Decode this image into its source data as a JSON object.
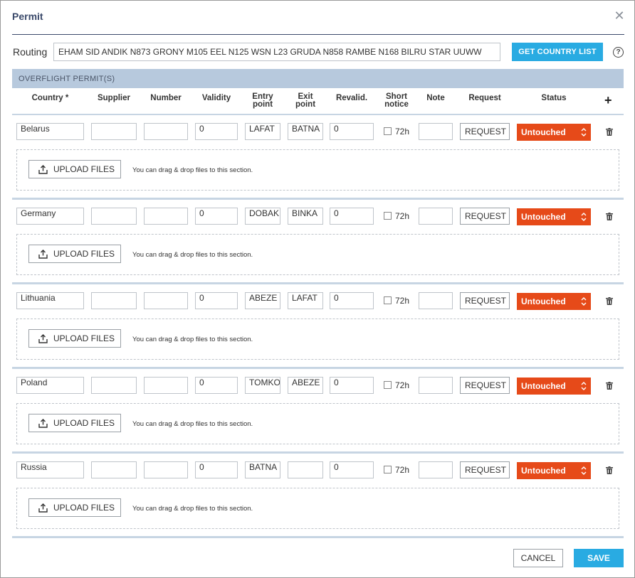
{
  "dialog": {
    "title": "Permit",
    "close_icon": "close-icon"
  },
  "routing": {
    "label": "Routing",
    "value": "EHAM SID ANDIK N873 GRONY M105 EEL N125 WSN L23 GRUDA N858 RAMBE N168 BILRU STAR UUWW",
    "get_country_list": "GET COUNTRY LIST",
    "help_glyph": "?"
  },
  "section": {
    "title": "OVERFLIGHT PERMIT(S)"
  },
  "columns": {
    "country": "Country *",
    "supplier": "Supplier",
    "number": "Number",
    "validity": "Validity",
    "entry_1": "Entry",
    "entry_2": "point",
    "exit_1": "Exit",
    "exit_2": "point",
    "revalid": "Revalid.",
    "short_1": "Short",
    "short_2": "notice",
    "note": "Note",
    "request": "Request",
    "status": "Status",
    "add": "+"
  },
  "permits": [
    {
      "country": "Belarus",
      "supplier": "",
      "number": "",
      "validity": "0",
      "entry": "LAFAT",
      "exit": "BATNA",
      "revalid": "0",
      "short_notice": "72h",
      "note": "",
      "request": "REQUEST",
      "status": "Untouched",
      "upload": "UPLOAD FILES",
      "hint": "You can drag & drop files to this section."
    },
    {
      "country": "Germany",
      "supplier": "",
      "number": "",
      "validity": "0",
      "entry": "DOBAK",
      "exit": "BINKA",
      "revalid": "0",
      "short_notice": "72h",
      "note": "",
      "request": "REQUEST",
      "status": "Untouched",
      "upload": "UPLOAD FILES",
      "hint": "You can drag & drop files to this section."
    },
    {
      "country": "Lithuania",
      "supplier": "",
      "number": "",
      "validity": "0",
      "entry": "ABEZE",
      "exit": "LAFAT",
      "revalid": "0",
      "short_notice": "72h",
      "note": "",
      "request": "REQUEST",
      "status": "Untouched",
      "upload": "UPLOAD FILES",
      "hint": "You can drag & drop files to this section."
    },
    {
      "country": "Poland",
      "supplier": "",
      "number": "",
      "validity": "0",
      "entry": "TOMKO",
      "exit": "ABEZE",
      "revalid": "0",
      "short_notice": "72h",
      "note": "",
      "request": "REQUEST",
      "status": "Untouched",
      "upload": "UPLOAD FILES",
      "hint": "You can drag & drop files to this section."
    },
    {
      "country": "Russia",
      "supplier": "",
      "number": "",
      "validity": "0",
      "entry": "BATNA",
      "exit": "",
      "revalid": "0",
      "short_notice": "72h",
      "note": "",
      "request": "REQUEST",
      "status": "Untouched",
      "upload": "UPLOAD FILES",
      "hint": "You can drag & drop files to this section."
    }
  ],
  "footer": {
    "cancel": "CANCEL",
    "save": "SAVE"
  },
  "colors": {
    "accent": "#29abe2",
    "status_untouched": "#e64a19",
    "section_bar": "#b7c9dd",
    "title": "#3b4a6b"
  }
}
